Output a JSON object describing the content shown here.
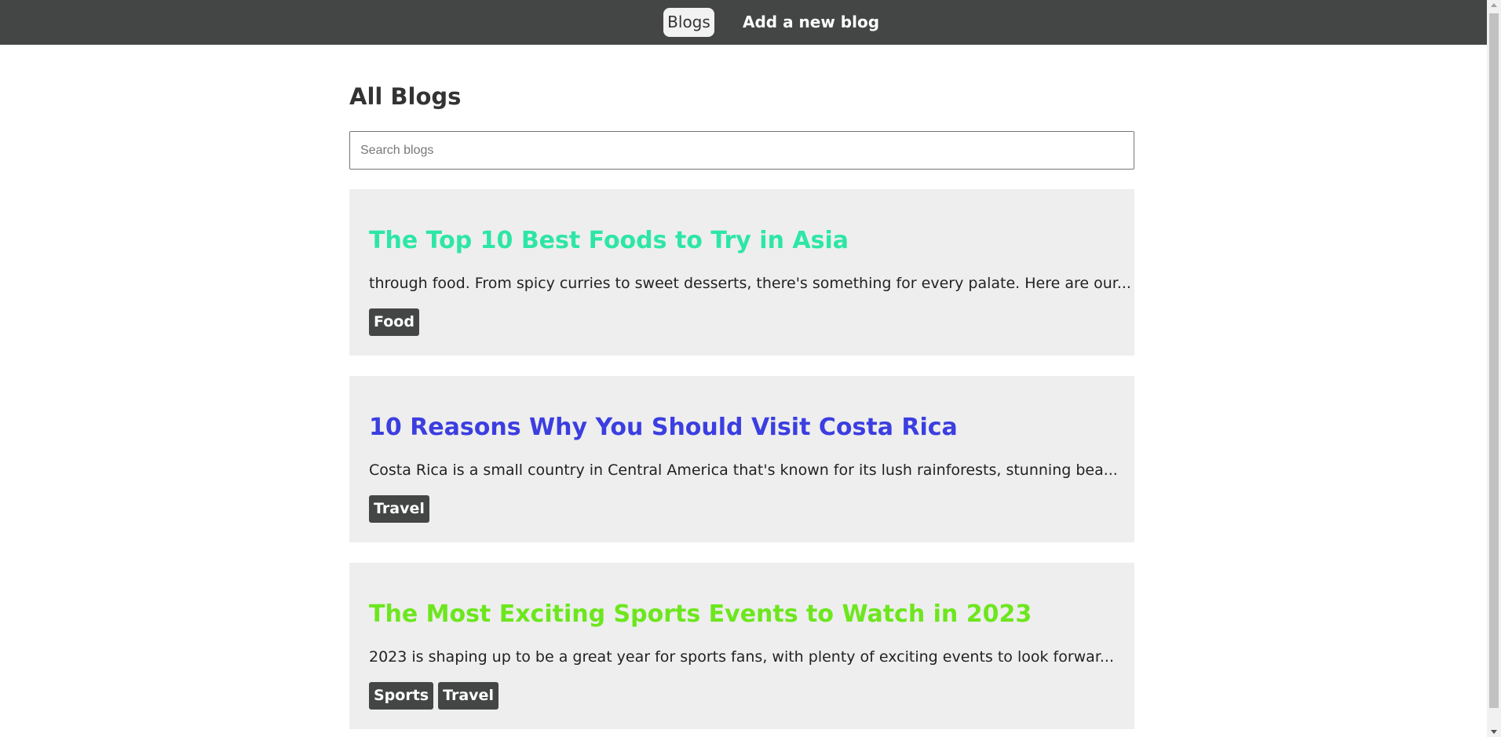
{
  "nav": {
    "blogs_label": "Blogs",
    "new_blog_label": "Add a new blog"
  },
  "main": {
    "title": "All Blogs",
    "search_placeholder": "Search blogs"
  },
  "posts": [
    {
      "title": "The Top 10 Best Foods to Try in Asia",
      "title_color": "#2de6a6",
      "excerpt": "through food. From spicy curries to sweet desserts, there's something for every palate. Here are our...",
      "tags": [
        "Food"
      ]
    },
    {
      "title": "10 Reasons Why You Should Visit Costa Rica",
      "title_color": "#3b3ee0",
      "excerpt": "Costa Rica is a small country in Central America that's known for its lush rainforests, stunning bea...",
      "tags": [
        "Travel"
      ]
    },
    {
      "title": "The Most Exciting Sports Events to Watch in 2023",
      "title_color": "#6de61e",
      "excerpt": "2023 is shaping up to be a great year for sports fans, with plenty of exciting events to look forwar...",
      "tags": [
        "Sports",
        "Travel"
      ]
    }
  ],
  "theme": {
    "nav_background": "#444645",
    "card_background": "#eeeeee",
    "tag_background": "#444645"
  }
}
